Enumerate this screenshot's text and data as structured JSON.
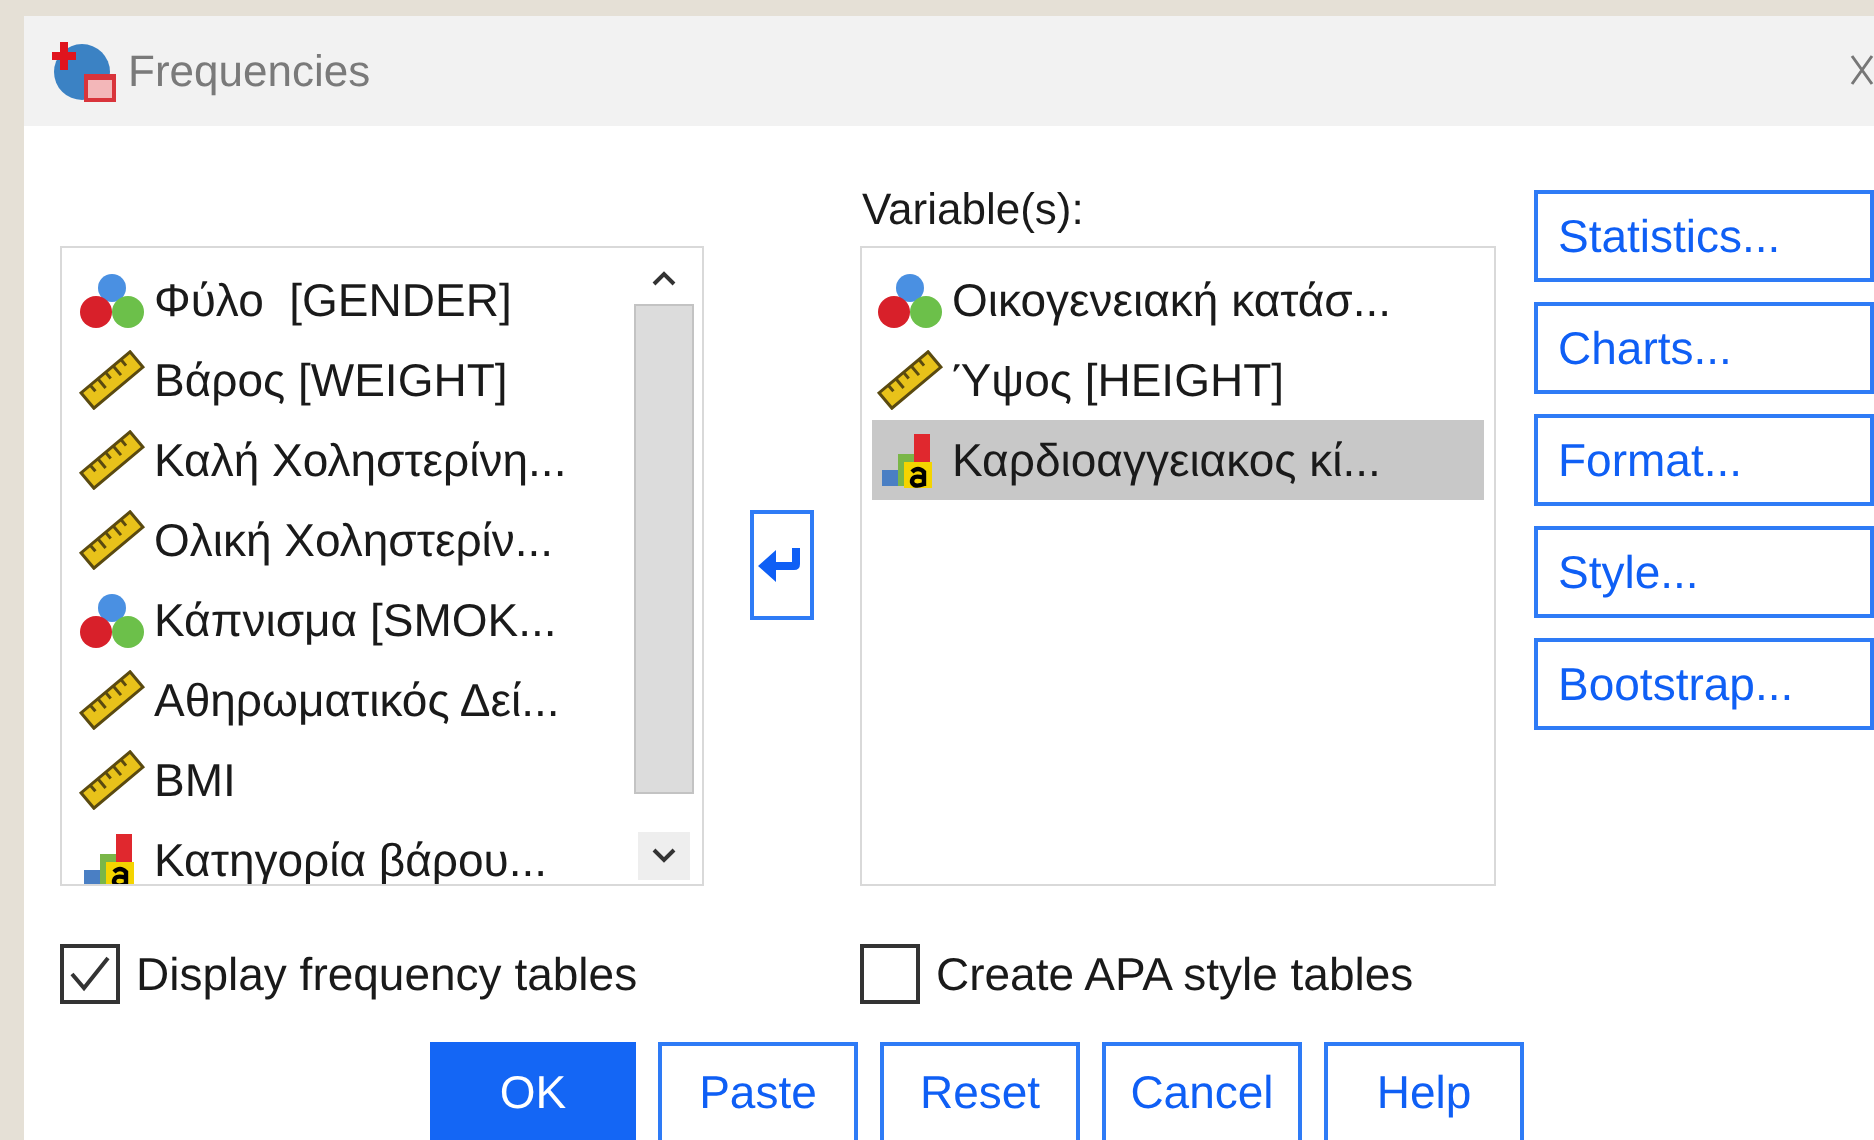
{
  "window": {
    "title": "Frequencies"
  },
  "source_list": {
    "items": [
      {
        "label": "Φύλο  [GENDER]",
        "kind": "nominal"
      },
      {
        "label": "Βάρος [WEIGHT]",
        "kind": "scale"
      },
      {
        "label": "Καλή Χοληστερίνη...",
        "kind": "scale"
      },
      {
        "label": "Ολική Χοληστερίν...",
        "kind": "scale"
      },
      {
        "label": "Κάπνισμα [SMOK...",
        "kind": "nominal"
      },
      {
        "label": "Αθηρωματικός Δεί...",
        "kind": "scale"
      },
      {
        "label": "BMI",
        "kind": "scale"
      },
      {
        "label": "Κατηγορία βάρου...",
        "kind": "ordinal"
      }
    ]
  },
  "variables": {
    "label": "Variable(s):",
    "items": [
      {
        "label": "Οικογενειακή κατάσ...",
        "kind": "nominal",
        "selected": false
      },
      {
        "label": "Ύψος [HEIGHT]",
        "kind": "scale",
        "selected": false
      },
      {
        "label": "Καρδιοαγγειακος κί...",
        "kind": "ordinal",
        "selected": true
      }
    ]
  },
  "side_buttons": [
    {
      "label": "Statistics..."
    },
    {
      "label": "Charts..."
    },
    {
      "label": "Format..."
    },
    {
      "label": "Style..."
    },
    {
      "label": "Bootstrap..."
    }
  ],
  "options": [
    {
      "label": "Display frequency tables",
      "checked": true
    },
    {
      "label": "Create APA style tables",
      "checked": false
    }
  ],
  "buttons": [
    {
      "label": "OK",
      "default": true
    },
    {
      "label": "Paste",
      "default": false
    },
    {
      "label": "Reset",
      "default": false
    },
    {
      "label": "Cancel",
      "default": false
    },
    {
      "label": "Help",
      "default": false
    }
  ]
}
